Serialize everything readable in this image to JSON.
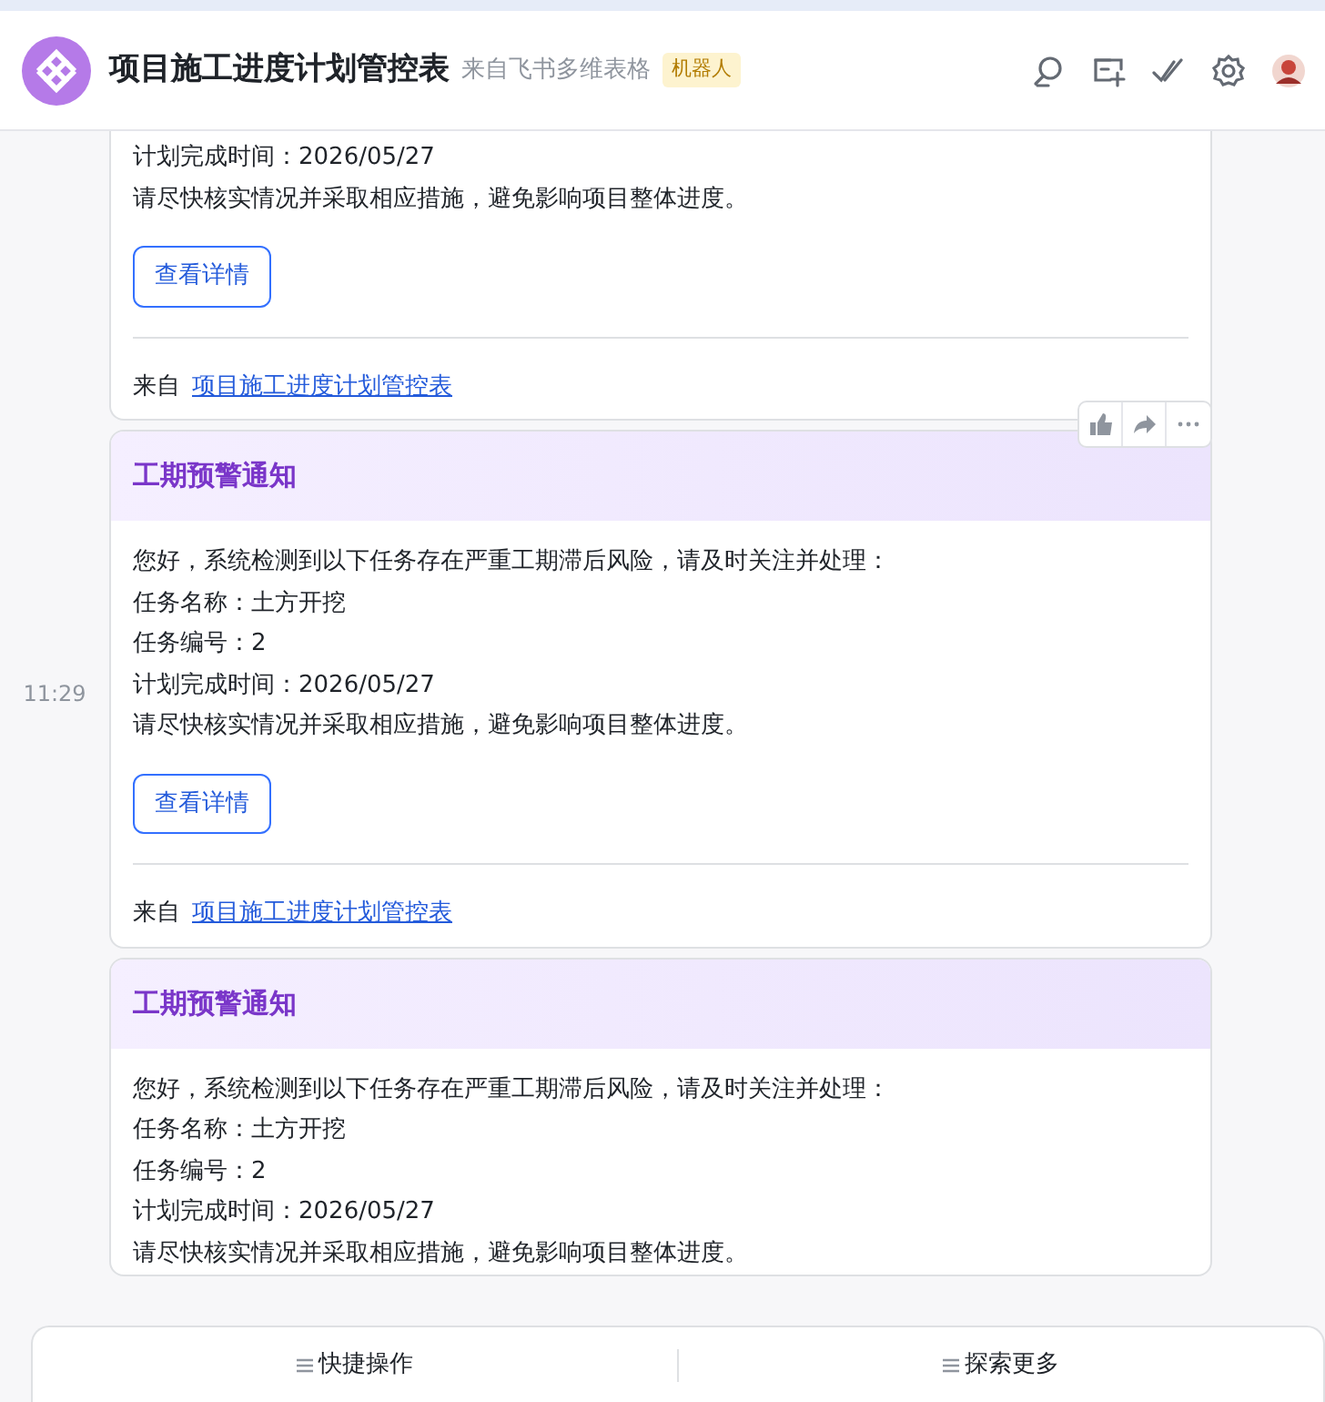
{
  "header": {
    "title": "项目施工进度计划管控表",
    "subtitle": "来自飞书多维表格",
    "tag": "机器人"
  },
  "messages": [
    {
      "lines": [
        "计划完成时间：2026/05/27",
        "请尽快核实情况并采取相应措施，避免影响项目整体进度。"
      ],
      "button": "查看详情",
      "source_label": "来自",
      "source_link": "项目施工进度计划管控表"
    },
    {
      "time": "11:29",
      "hovered": true,
      "title": "工期预警通知",
      "lines": [
        "您好，系统检测到以下任务存在严重工期滞后风险，请及时关注并处理：",
        "任务名称：土方开挖",
        "任务编号：2",
        "计划完成时间：2026/05/27",
        "请尽快核实情况并采取相应措施，避免影响项目整体进度。"
      ],
      "button": "查看详情",
      "source_label": "来自",
      "source_link": "项目施工进度计划管控表"
    },
    {
      "title": "工期预警通知",
      "lines": [
        "您好，系统检测到以下任务存在严重工期滞后风险，请及时关注并处理：",
        "任务名称：土方开挖",
        "任务编号：2",
        "计划完成时间：2026/05/27",
        "请尽快核实情况并采取相应措施，避免影响项目整体进度。"
      ]
    }
  ],
  "bottom_bar": [
    "快捷操作",
    "探索更多"
  ]
}
